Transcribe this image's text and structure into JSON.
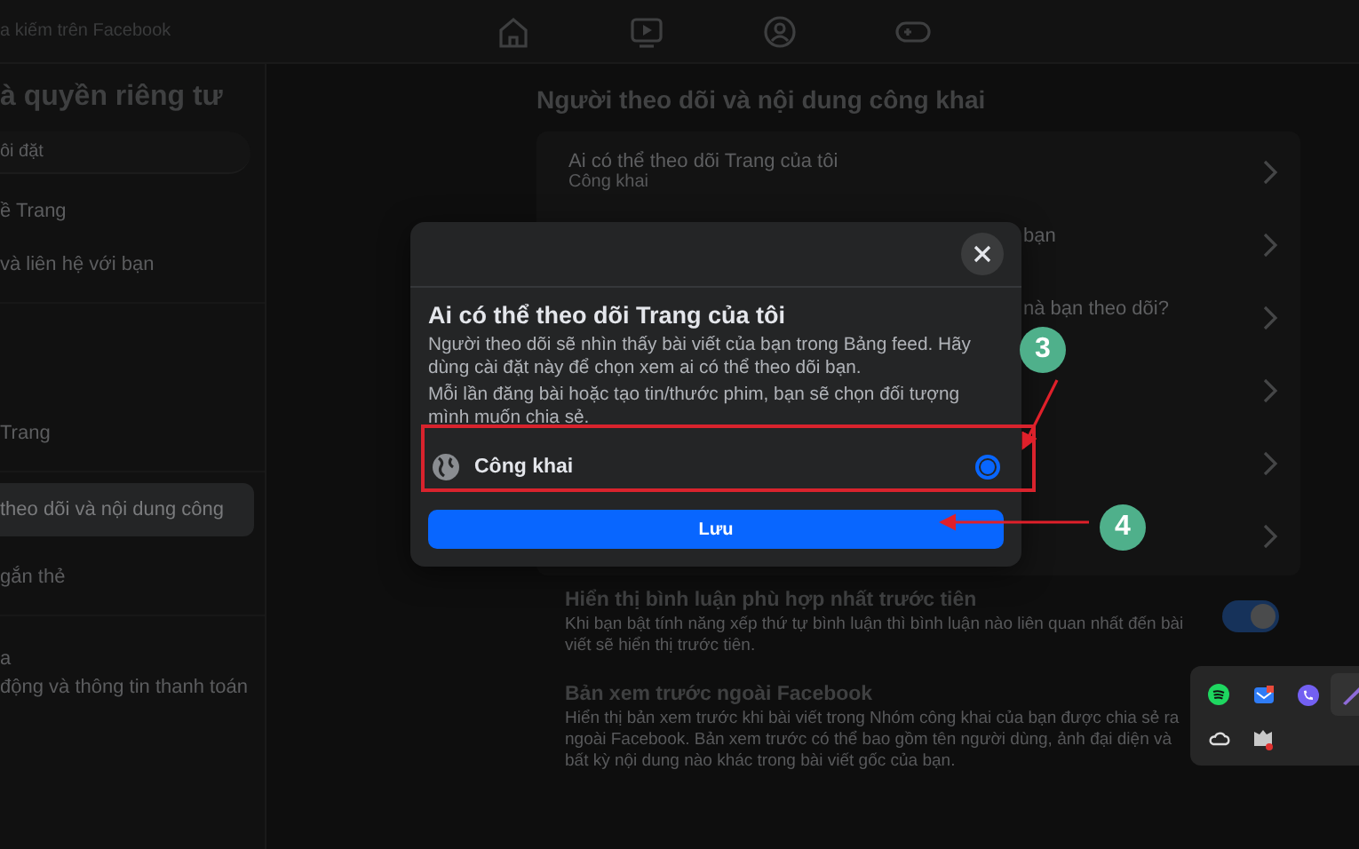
{
  "top_bar": {
    "search_placeholder": "a kiếm trên Facebook",
    "nav_icons": [
      {
        "kind": "home"
      },
      {
        "kind": "video"
      },
      {
        "kind": "groups"
      },
      {
        "kind": "gaming"
      }
    ]
  },
  "sidebar": {
    "title": "à quyền riêng tư",
    "search_placeholder": "ôi đặt",
    "sections": [
      {
        "items": [
          {
            "label": "ề Trang",
            "selected": false
          },
          {
            "label": "và liên hệ với bạn",
            "selected": false
          }
        ]
      },
      {
        "items": [
          {
            "label": "Trang",
            "selected": false
          }
        ]
      },
      {
        "items": [
          {
            "label": "theo dõi và nội dung công",
            "selected": true
          },
          {
            "label": "gắn thẻ",
            "selected": false
          }
        ]
      }
    ],
    "footer_lines": [
      "a",
      "động và thông tin thanh toán"
    ]
  },
  "main": {
    "heading": "Người theo dõi và nội dung công khai",
    "rows": [
      {
        "kind": "full",
        "title": "Ai có thể theo dõi Trang của tôi",
        "subtitle": "Công khai"
      },
      {
        "kind": "covered",
        "title": "bạn"
      },
      {
        "kind": "covered",
        "title": "nà bạn theo dõi?"
      },
      {
        "kind": "empty"
      },
      {
        "kind": "empty"
      },
      {
        "kind": "empty"
      }
    ],
    "settings": [
      {
        "kind": "toggle",
        "title": "Hiển thị bình luận phù hợp nhất trước tiên",
        "description": "Khi bạn bật tính năng xếp thứ tự bình luận thì bình luận nào liên quan nhất đến bài viết sẽ hiển thị trước tiên.",
        "on": true
      },
      {
        "kind": "text",
        "title": "Bản xem trước ngoài Facebook",
        "description": "Hiển thị bản xem trước khi bài viết trong Nhóm công khai của bạn được chia sẻ ra ngoài Facebook. Bản xem trước có thể bao gồm tên người dùng, ảnh đại diện và bất kỳ nội dung nào khác trong bài viết gốc của bạn."
      }
    ]
  },
  "modal": {
    "title": "Ai có thể theo dõi Trang của tôi",
    "paragraphs": [
      "Người theo dõi sẽ nhìn thấy bài viết của bạn trong Bảng feed. Hãy dùng cài đặt này để chọn xem ai có thể theo dõi bạn.",
      "Mỗi lần đăng bài hoặc tạo tin/thước phim, bạn sẽ chọn đối tượng mình muốn chia sẻ."
    ],
    "option": {
      "label": "Công khai",
      "selected": true
    },
    "save_button": "Lưu"
  },
  "annotations": [
    {
      "kind": "option",
      "label": "3"
    },
    {
      "kind": "button",
      "label": "4"
    }
  ],
  "tray_icons": [
    {
      "kind": "music"
    },
    {
      "kind": "mail"
    },
    {
      "kind": "phone"
    },
    {
      "kind": "pen"
    },
    {
      "kind": "cloud"
    },
    {
      "kind": "shield"
    }
  ]
}
